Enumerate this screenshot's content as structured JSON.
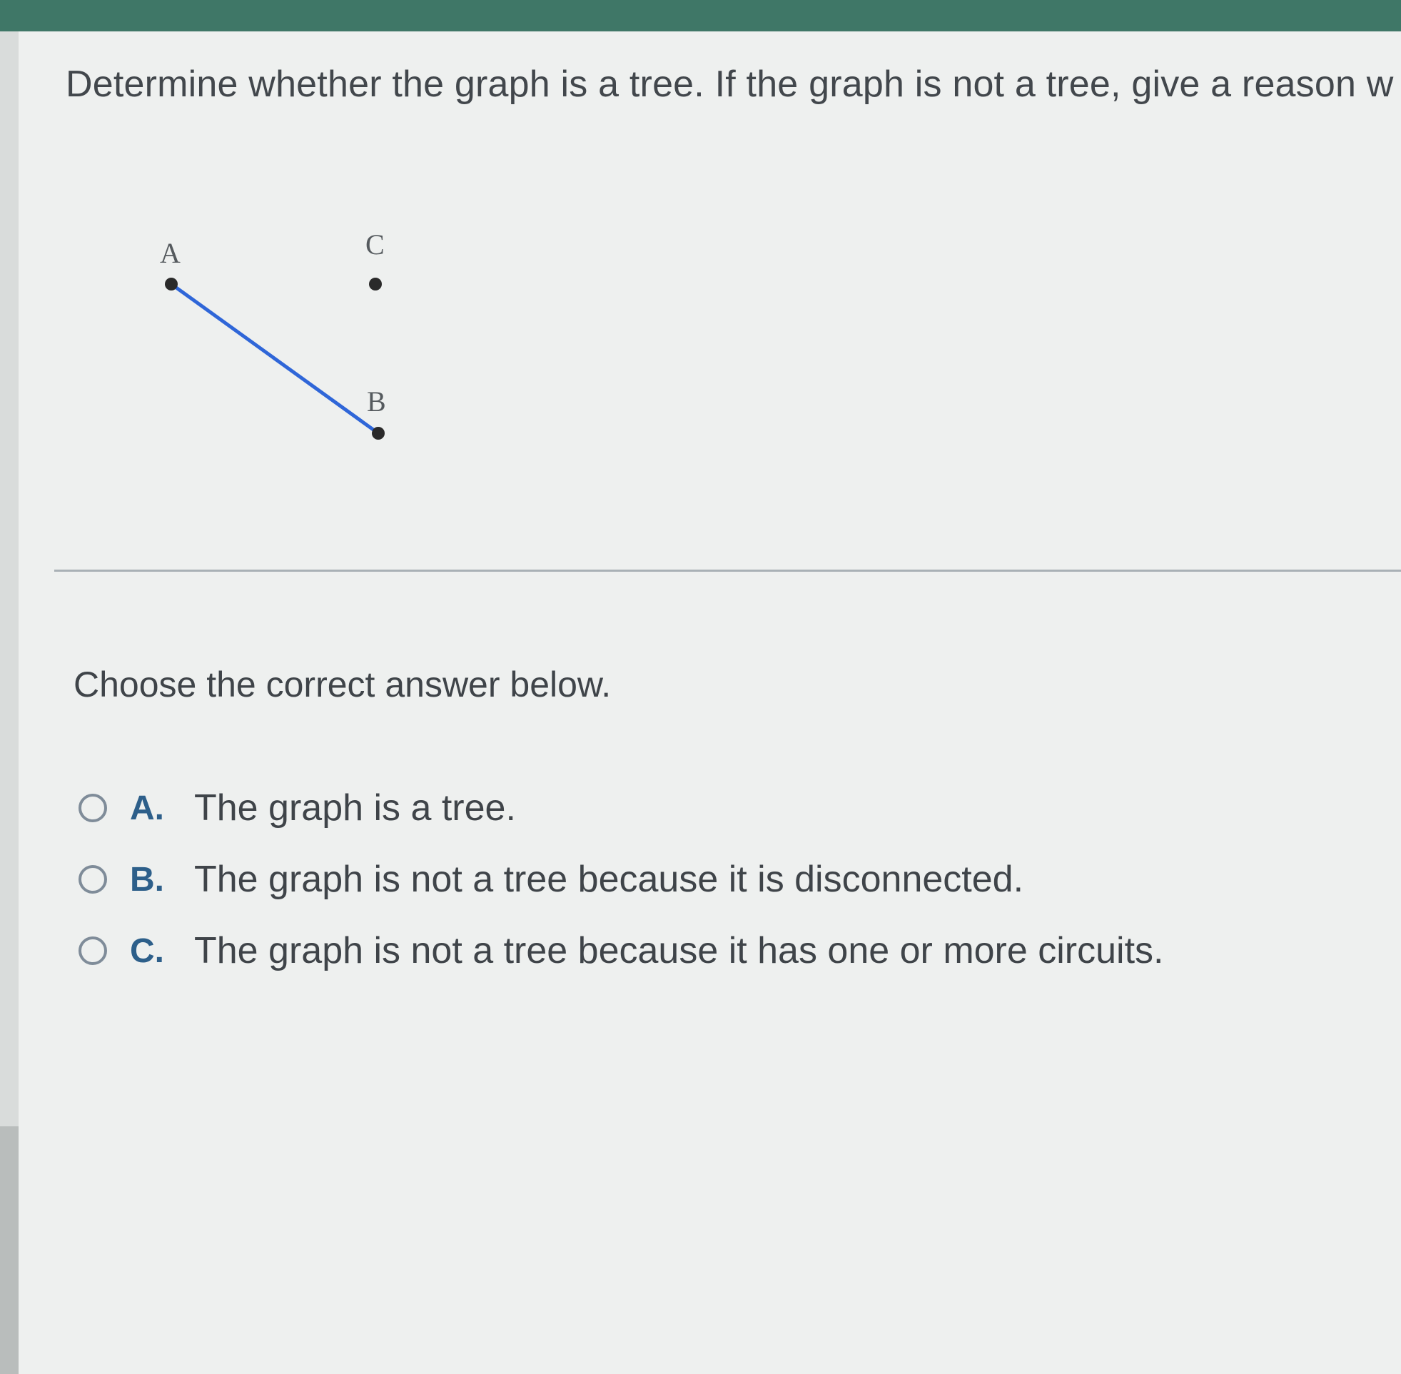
{
  "question": {
    "text": "Determine whether the graph is a tree. If the graph is not a tree, give a reason w"
  },
  "graph": {
    "vertices": [
      {
        "label": "A"
      },
      {
        "label": "C"
      },
      {
        "label": "B"
      }
    ],
    "edges": [
      {
        "from": "A",
        "to": "B"
      }
    ],
    "edge_color": "#2f66d8",
    "vertex_color": "#2a2a2a"
  },
  "prompt": {
    "text": "Choose the correct answer below."
  },
  "options": [
    {
      "letter": "A.",
      "text": "The graph is a tree."
    },
    {
      "letter": "B.",
      "text": "The graph is not a tree because it is disconnected."
    },
    {
      "letter": "C.",
      "text": "The graph is not a tree because it has one or more circuits."
    }
  ],
  "colors": {
    "header_bar": "#3f7767",
    "option_letter": "#2d5f8a"
  }
}
